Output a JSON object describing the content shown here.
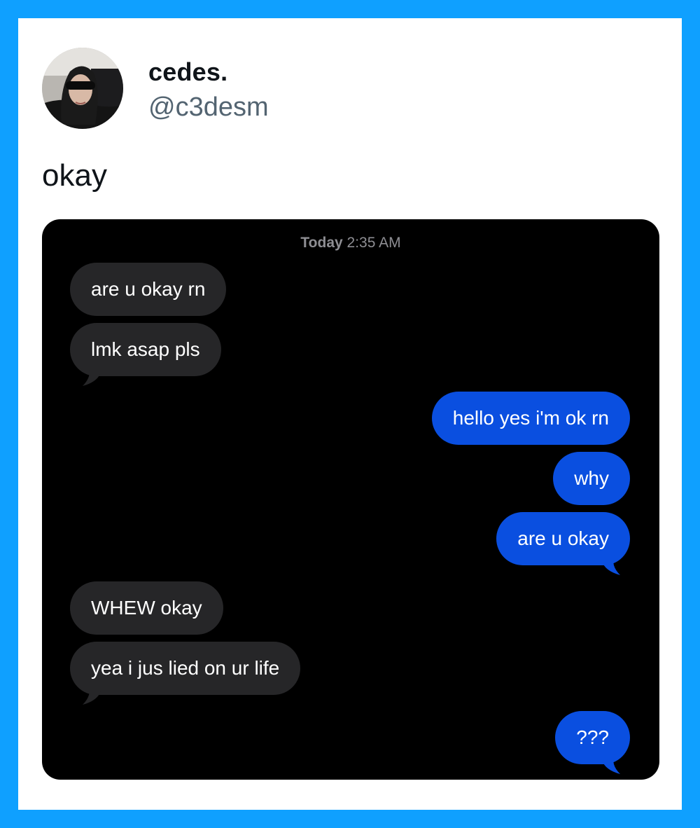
{
  "tweet": {
    "display_name": "cedes.",
    "handle": "@c3desm",
    "text": "okay"
  },
  "conversation": {
    "timestamp_day": "Today",
    "timestamp_time": "2:35 AM",
    "messages": [
      {
        "direction": "incoming",
        "text": "are u okay rn"
      },
      {
        "direction": "incoming",
        "text": "lmk asap pls"
      },
      {
        "direction": "outgoing",
        "text": "hello yes i'm ok rn"
      },
      {
        "direction": "outgoing",
        "text": "why"
      },
      {
        "direction": "outgoing",
        "text": "are u okay"
      },
      {
        "direction": "incoming",
        "text": "WHEW okay"
      },
      {
        "direction": "incoming",
        "text": "yea i jus lied on ur life"
      },
      {
        "direction": "outgoing",
        "text": "???"
      }
    ]
  },
  "colors": {
    "border": "#0fa0ff",
    "incoming_bubble": "#262628",
    "outgoing_bubble": "#0a4fe0",
    "handle_text": "#536471"
  }
}
